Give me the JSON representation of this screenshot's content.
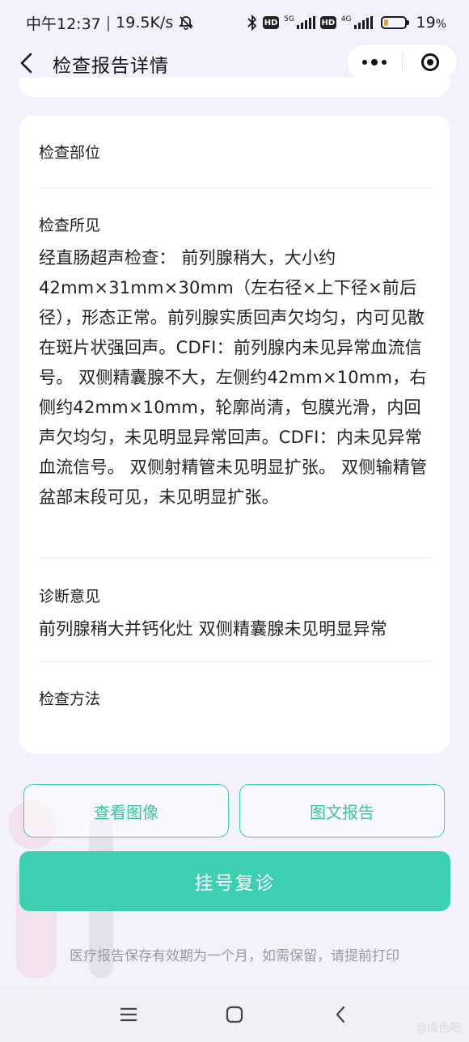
{
  "status_bar": {
    "time": "中午12:37",
    "speed": "19.5K/s",
    "net1": "5G",
    "net2": "4G",
    "hd": "HD",
    "battery_level": 0.19,
    "battery_text": "19",
    "battery_unit": "%"
  },
  "nav": {
    "title": "检查报告详情"
  },
  "report": {
    "sections": [
      {
        "label": "检查部位",
        "content": ""
      },
      {
        "label": "检查所见",
        "content": "经直肠超声检查： 前列腺稍大，大小约42mm×31mm×30mm（左右径×上下径×前后径），形态正常。前列腺实质回声欠均匀，内可见散在斑片状强回声。CDFI：前列腺内未见异常血流信号。 双侧精囊腺不大，左侧约42mm×10mm，右侧约42mm×10mm，轮廓尚清，包膜光滑，内回声欠均匀，未见明显异常回声。CDFI：内未见异常血流信号。 双侧射精管未见明显扩张。 双侧输精管盆部末段可见，未见明显扩张。"
      },
      {
        "label": "诊断意见",
        "content": "前列腺稍大并钙化灶 双侧精囊腺未见明显异常"
      },
      {
        "label": "检查方法",
        "content": ""
      }
    ]
  },
  "actions": {
    "view_images": "查看图像",
    "text_report": "图文报告",
    "register_revisit": "挂号复诊"
  },
  "footnote": "医疗报告保存有效期为一个月，如需保留，请提前打印",
  "watermark": "@成色吧",
  "colors": {
    "accent": "#3ccfb2",
    "background": "#f3f1fb"
  }
}
